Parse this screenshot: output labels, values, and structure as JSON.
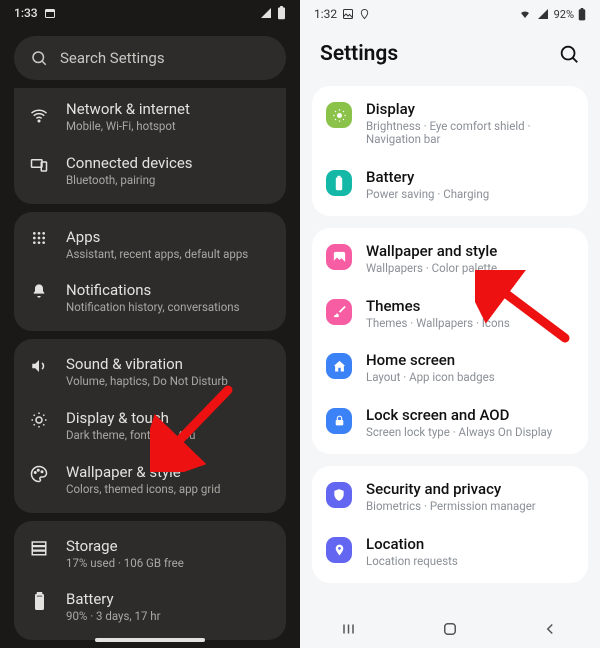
{
  "left": {
    "status": {
      "time": "1:33",
      "icons_right": [
        "signal",
        "battery"
      ]
    },
    "search_placeholder": "Search Settings",
    "groups": [
      [
        {
          "icon": "wifi",
          "title": "Network & internet",
          "sub": "Mobile, Wi-Fi, hotspot"
        },
        {
          "icon": "devices",
          "title": "Connected devices",
          "sub": "Bluetooth, pairing"
        }
      ],
      [
        {
          "icon": "apps",
          "title": "Apps",
          "sub": "Assistant, recent apps, default apps"
        },
        {
          "icon": "bell",
          "title": "Notifications",
          "sub": "Notification history, conversations"
        }
      ],
      [
        {
          "icon": "sound",
          "title": "Sound & vibration",
          "sub": "Volume, haptics, Do Not Disturb"
        },
        {
          "icon": "display",
          "title": "Display & touch",
          "sub": "Dark theme, font size, tou"
        },
        {
          "icon": "palette",
          "title": "Wallpaper & style",
          "sub": "Colors, themed icons, app grid"
        }
      ],
      [
        {
          "icon": "storage",
          "title": "Storage",
          "sub": "17% used · 106 GB free"
        },
        {
          "icon": "battery",
          "title": "Battery",
          "sub": "90% · 3 days, 17 hr"
        }
      ]
    ]
  },
  "right": {
    "status": {
      "time": "1:32",
      "battery_pct": "92%"
    },
    "header_title": "Settings",
    "cards": [
      [
        {
          "color": "#8bc34a",
          "icon": "sun",
          "title": "Display",
          "sub": "Brightness · Eye comfort shield · Navigation bar"
        },
        {
          "color": "#14b8a6",
          "icon": "battery",
          "title": "Battery",
          "sub": "Power saving · Charging"
        }
      ],
      [
        {
          "color": "#f65da3",
          "icon": "image",
          "title": "Wallpaper and style",
          "sub": "Wallpapers · Color palette"
        },
        {
          "color": "#f65da3",
          "icon": "brush",
          "title": "Themes",
          "sub": "Themes · Wallpapers · Icons"
        },
        {
          "color": "#3b82f6",
          "icon": "home",
          "title": "Home screen",
          "sub": "Layout · App icon badges"
        },
        {
          "color": "#3b82f6",
          "icon": "lock",
          "title": "Lock screen and AOD",
          "sub": "Screen lock type · Always On Display"
        }
      ],
      [
        {
          "color": "#6366f1",
          "icon": "shield",
          "title": "Security and privacy",
          "sub": "Biometrics · Permission manager"
        },
        {
          "color": "#6366f1",
          "icon": "pin",
          "title": "Location",
          "sub": "Location requests"
        }
      ]
    ]
  }
}
